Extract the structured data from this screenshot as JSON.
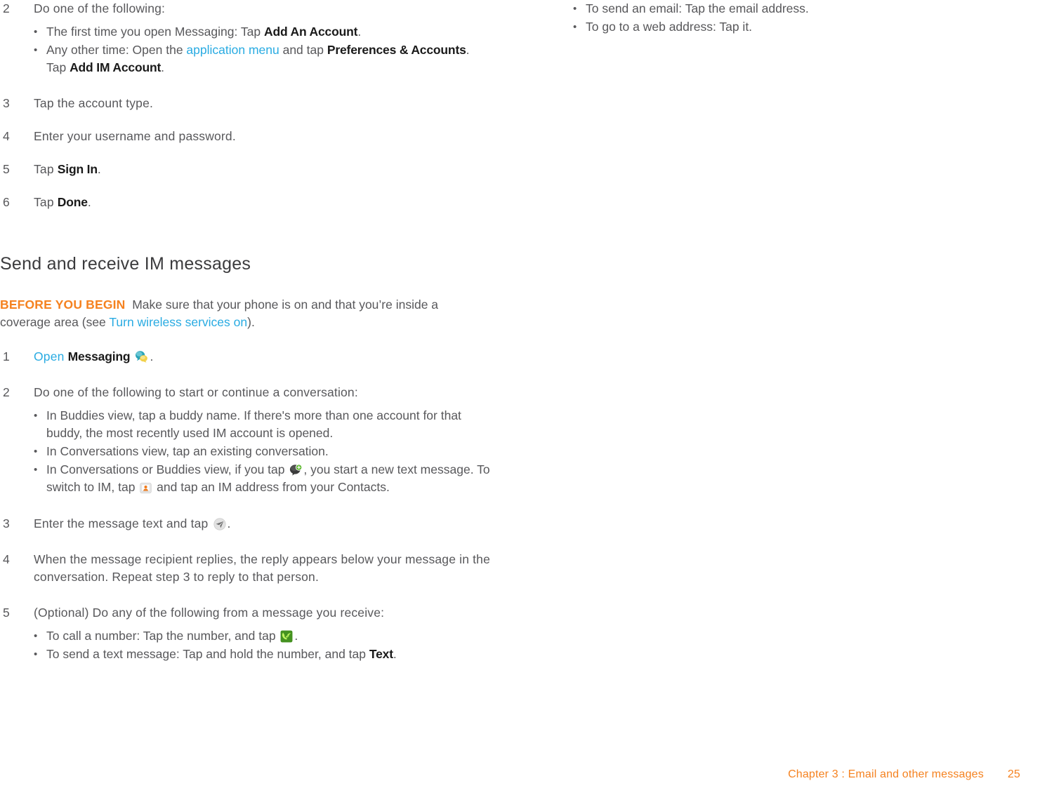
{
  "page": {
    "number": "25",
    "footer_chapter": "Chapter 3 :  Email and other messages"
  },
  "colors": {
    "link": "#29abe2",
    "accent_orange": "#f58220",
    "body_text": "#58585b",
    "bold_text": "#1a1a1a"
  },
  "left_column": {
    "step2": {
      "num": "2",
      "text": "Do one of the following:",
      "bullets": [
        {
          "parts": [
            {
              "t": "The first time you open Messaging: Tap ",
              "style": "normal"
            },
            {
              "t": "Add An Account",
              "style": "bold"
            },
            {
              "t": ".",
              "style": "normal"
            }
          ]
        },
        {
          "parts": [
            {
              "t": "Any other time: Open the ",
              "style": "normal"
            },
            {
              "t": "application menu",
              "style": "link"
            },
            {
              "t": " and tap ",
              "style": "normal"
            },
            {
              "t": "Preferences & Accounts",
              "style": "bold"
            },
            {
              "t": ". Tap ",
              "style": "normal"
            },
            {
              "t": "Add IM Account",
              "style": "bold"
            },
            {
              "t": ".",
              "style": "normal"
            }
          ]
        }
      ]
    },
    "step3": {
      "num": "3",
      "text": "Tap the account type."
    },
    "step4": {
      "num": "4",
      "text": "Enter your username and password."
    },
    "step5": {
      "num": "5",
      "prefix": "Tap ",
      "bold": "Sign In",
      "suffix": "."
    },
    "step6": {
      "num": "6",
      "prefix": "Tap ",
      "bold": "Done",
      "suffix": "."
    },
    "section_heading": "Send and receive IM messages",
    "before_you_begin": {
      "label": "BEFORE YOU BEGIN",
      "text_1": "Make sure that your phone is on and that you’re inside a coverage area (see ",
      "link": "Turn wireless services on",
      "text_2": ")."
    },
    "step_open": {
      "num": "1",
      "link": "Open",
      "bold": "Messaging",
      "icon": "messaging-app-icon",
      "suffix": "."
    },
    "step_conversation": {
      "num": "2",
      "text": "Do one of the following to start or continue a conversation:",
      "bullets": [
        {
          "parts": [
            {
              "t": "In Buddies view, tap a buddy name. If there's more than one account for that buddy, the most recently used IM account is opened.",
              "style": "normal"
            }
          ]
        },
        {
          "parts": [
            {
              "t": "In Conversations view, tap an existing conversation.",
              "style": "normal"
            }
          ]
        },
        {
          "parts": [
            {
              "t": "In Conversations or Buddies view, if you tap ",
              "style": "normal"
            },
            {
              "t": "new-message-icon",
              "style": "icon"
            },
            {
              "t": ", you start a new text message. To switch to IM, tap ",
              "style": "normal"
            },
            {
              "t": "contacts-picker-icon",
              "style": "icon"
            },
            {
              "t": " and tap an IM address from your Contacts.",
              "style": "normal"
            }
          ]
        }
      ]
    },
    "step_send": {
      "num": "3",
      "prefix": "Enter the message text and tap ",
      "icon": "send-arrow-icon",
      "suffix": "."
    },
    "step_reply": {
      "num": "4",
      "text": "When the message recipient replies, the reply appears below your message in the conversation. Repeat step 3 to reply to that person."
    },
    "step_optional": {
      "num": "5",
      "text": "(Optional) Do any of the following from a message you receive:",
      "bullets": [
        {
          "parts": [
            {
              "t": "To call a number: Tap the number, and tap ",
              "style": "normal"
            },
            {
              "t": "phone-call-icon",
              "style": "icon"
            },
            {
              "t": ".",
              "style": "normal"
            }
          ]
        },
        {
          "parts": [
            {
              "t": "To send a text message: Tap and hold the number, and tap ",
              "style": "normal"
            },
            {
              "t": "Text",
              "style": "bold"
            },
            {
              "t": ".",
              "style": "normal"
            }
          ]
        }
      ]
    }
  },
  "right_column": {
    "bullets": [
      "To send an email: Tap the email address.",
      "To go to a web address: Tap it."
    ]
  }
}
